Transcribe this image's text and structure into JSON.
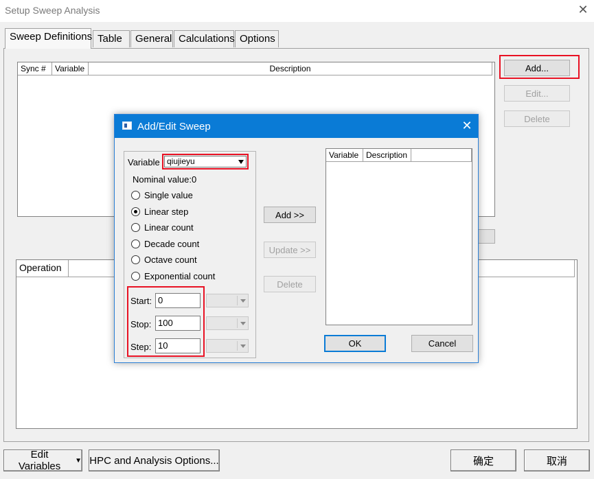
{
  "window": {
    "title": "Setup Sweep Analysis"
  },
  "tabs": [
    {
      "label": "Sweep Definitions",
      "active": true
    },
    {
      "label": "Table"
    },
    {
      "label": "General"
    },
    {
      "label": "Calculations"
    },
    {
      "label": "Options"
    }
  ],
  "sweep_list": {
    "columns": [
      "Sync #",
      "Variable",
      "Description"
    ]
  },
  "side_buttons": {
    "add": "Add...",
    "edit": "Edit...",
    "delete": "Delete"
  },
  "operation_list": {
    "columns": [
      "Operation"
    ]
  },
  "dialog": {
    "title": "Add/Edit Sweep",
    "variable_label": "Variable",
    "variable_value": "qiujieyu",
    "nominal_label": "Nominal value:",
    "nominal_value": "0",
    "options": [
      "Single value",
      "Linear step",
      "Linear count",
      "Decade count",
      "Octave count",
      "Exponential count"
    ],
    "selected_option": "Linear step",
    "start_label": "Start:",
    "start_value": "0",
    "stop_label": "Stop:",
    "stop_value": "100",
    "step_label": "Step:",
    "step_value": "10",
    "add_button": "Add >>",
    "update_button": "Update >>",
    "delete_button": "Delete",
    "list_columns": [
      "Variable",
      "Description"
    ],
    "ok_button": "OK",
    "cancel_button": "Cancel"
  },
  "footer": {
    "edit_variables": "Edit Variables",
    "hpc_options": "HPC and Analysis Options...",
    "confirm": "确定",
    "cancel": "取消"
  },
  "colors": {
    "highlight": "#e81123",
    "dialog_title": "#0a7bd6"
  }
}
